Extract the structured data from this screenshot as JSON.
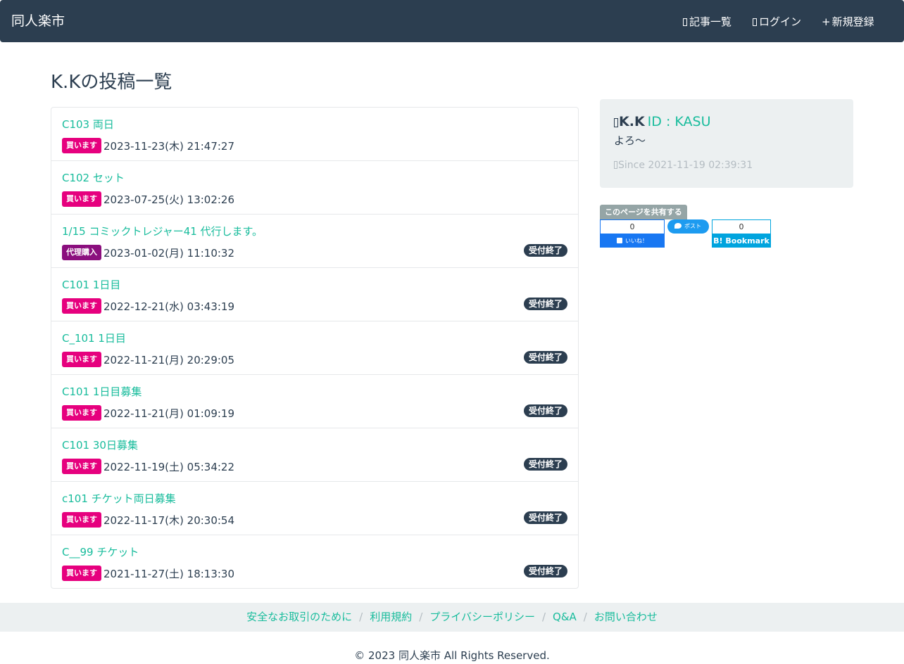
{
  "navbar": {
    "brand": "同人楽市",
    "items": [
      {
        "label": "記事一覧",
        "icon": "list-icon"
      },
      {
        "label": "ログイン",
        "icon": "login-icon"
      },
      {
        "label": "新規登録",
        "icon": "plus-icon",
        "prefix": "+"
      }
    ]
  },
  "page": {
    "title": "K.Kの投稿一覧"
  },
  "posts": [
    {
      "title": "C103 両日",
      "badge": "買います",
      "date": "2023-11-23(木) 21:47:27",
      "status": ""
    },
    {
      "title": "C102 セット",
      "badge": "買います",
      "date": "2023-07-25(火) 13:02:26",
      "status": ""
    },
    {
      "title": "1/15 コミックトレジャー41 代行します。",
      "badge": "代理購入",
      "date": "2023-01-02(月) 11:10:32",
      "status": "受付終了"
    },
    {
      "title": "C101 1日目",
      "badge": "買います",
      "date": "2022-12-21(水) 03:43:19",
      "status": "受付終了"
    },
    {
      "title": "C_101 1日目",
      "badge": "買います",
      "date": "2022-11-21(月) 20:29:05",
      "status": "受付終了"
    },
    {
      "title": "C101 1日目募集",
      "badge": "買います",
      "date": "2022-11-21(月) 01:09:19",
      "status": "受付終了"
    },
    {
      "title": "C101 30日募集",
      "badge": "買います",
      "date": "2022-11-19(土) 05:34:22",
      "status": "受付終了"
    },
    {
      "title": "c101 チケット両日募集",
      "badge": "買います",
      "date": "2022-11-17(木) 20:30:54",
      "status": "受付終了"
    },
    {
      "title": "C__99 チケット",
      "badge": "買います",
      "date": "2021-11-27(土) 18:13:30",
      "status": "受付終了"
    }
  ],
  "profile": {
    "name": "K.K",
    "id": "ID : KASU",
    "bio": "よろ〜",
    "since": "Since 2021-11-19 02:39:31"
  },
  "share": {
    "label": "このページを共有する",
    "facebook_count": "0",
    "facebook_label": "いいね！",
    "twitter_label": "ポスト",
    "hatena_count": "0",
    "hatena_label": "B! Bookmark"
  },
  "footer": {
    "links": [
      "安全なお取引のために",
      "利用規約",
      "プライバシーポリシー",
      "Q&A",
      "お問い合わせ"
    ],
    "separator": "/",
    "copyright": "© 2023 同人楽市 All Rights Reserved."
  },
  "colors": {
    "navbar": "#2c3e50",
    "link": "#18bc9c",
    "buy_badge": "#e6007e",
    "proxy_badge": "#8b0f7e",
    "closed_badge": "#2c3e50",
    "panel": "#ecf0f1"
  }
}
